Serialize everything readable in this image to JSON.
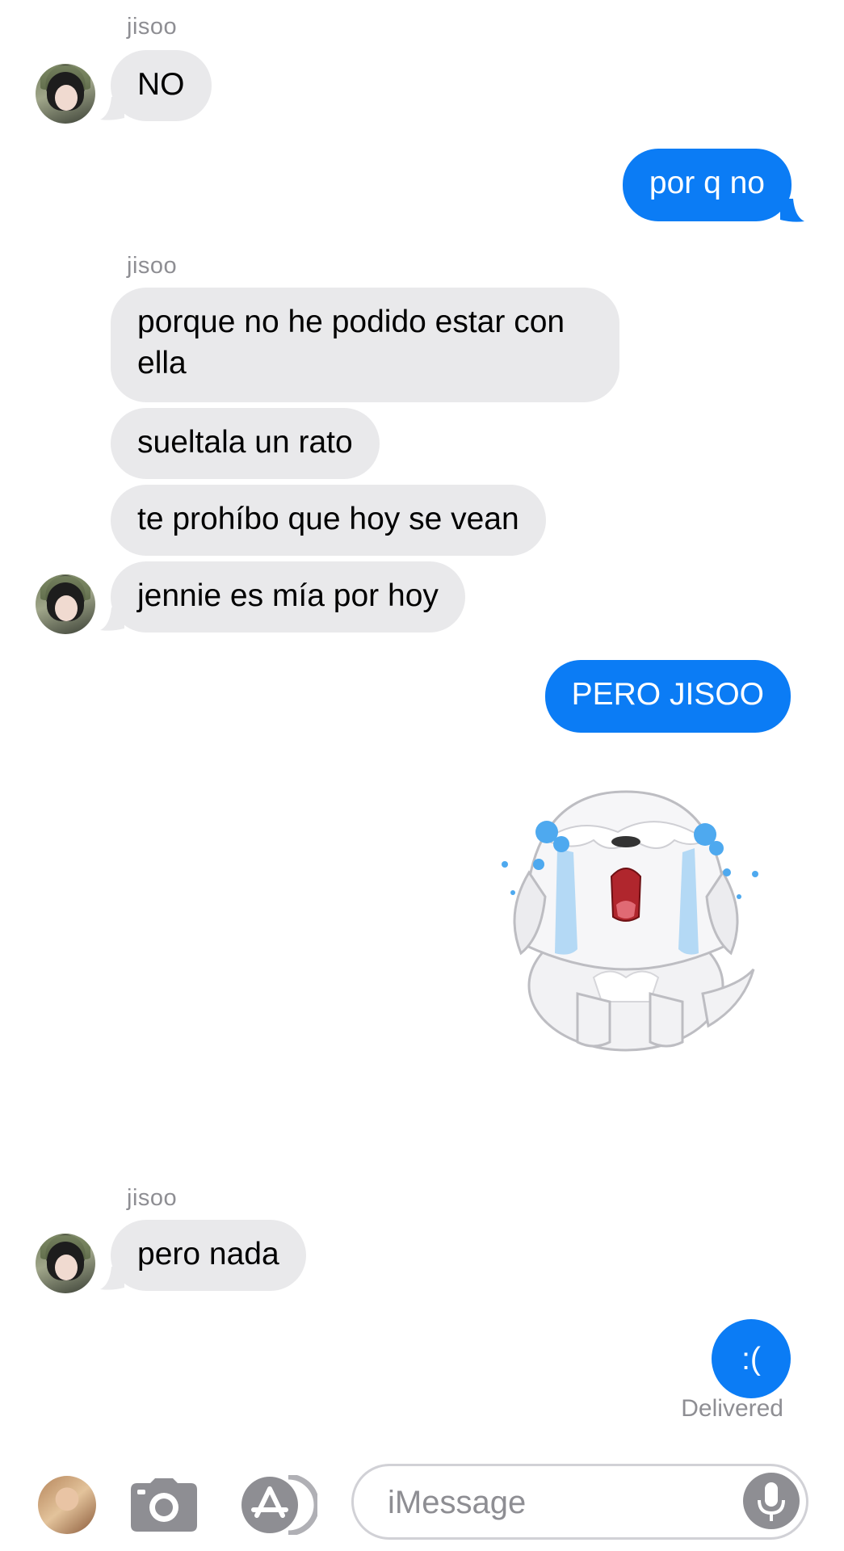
{
  "conversation": {
    "sender_name": "jisoo",
    "messages": [
      {
        "from": "jisoo",
        "text": "NO"
      },
      {
        "from": "me",
        "text": "por q no"
      },
      {
        "from": "jisoo",
        "text": "porque no he podido estar con ella"
      },
      {
        "from": "jisoo",
        "text": "sueltala un rato"
      },
      {
        "from": "jisoo",
        "text": "te prohíbo que hoy se vean"
      },
      {
        "from": "jisoo",
        "text": "jennie es mía por hoy"
      },
      {
        "from": "me",
        "text": "PERO JISOO"
      },
      {
        "from": "me",
        "text": ""
      },
      {
        "from": "jisoo",
        "text": "pero nada"
      },
      {
        "from": "me",
        "text": ":("
      }
    ],
    "status": "Delivered"
  },
  "input_bar": {
    "placeholder": "iMessage",
    "value": ""
  },
  "colors": {
    "incoming_bubble": "#e9e9eb",
    "outgoing_bubble": "#0b7cf5",
    "meta_text": "#8e8e93"
  },
  "icons": {
    "camera": "camera-icon",
    "apps": "app-store-icon",
    "mic": "microphone-icon"
  }
}
